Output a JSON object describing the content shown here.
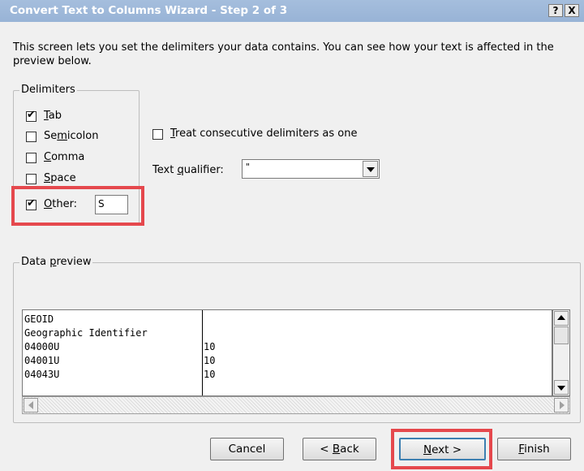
{
  "window": {
    "title": "Convert Text to Columns Wizard - Step 2 of 3",
    "help_label": "?",
    "close_label": "X"
  },
  "intro_text": "This screen lets you set the delimiters your data contains.  You can see how your text is affected in the preview below.",
  "delimiters": {
    "legend": "Delimiters",
    "tab": {
      "label_hot": "T",
      "label_rest": "ab",
      "checked": true
    },
    "semicolon": {
      "label_pre": "Se",
      "label_hot": "m",
      "label_rest": "icolon",
      "checked": false
    },
    "comma": {
      "label_hot": "C",
      "label_rest": "omma",
      "checked": false
    },
    "space": {
      "label_hot": "S",
      "label_rest": "pace",
      "checked": false
    },
    "other": {
      "label_hot": "O",
      "label_rest": "ther:",
      "checked": true,
      "value": "S"
    }
  },
  "consecutive": {
    "label_hot": "T",
    "label_rest": "reat consecutive delimiters as one",
    "checked": false
  },
  "qualifier": {
    "label_pre": "Text ",
    "label_hot": "q",
    "label_rest": "ualifier:",
    "value": "\""
  },
  "preview": {
    "legend_pre": "Data ",
    "legend_hot": "p",
    "legend_rest": "review",
    "rows": [
      {
        "c1": "GEOID",
        "c2": ""
      },
      {
        "c1": "Geographic Identifier",
        "c2": ""
      },
      {
        "c1": "04000U",
        "c2": "10"
      },
      {
        "c1": "04001U",
        "c2": "10"
      },
      {
        "c1": "04043U",
        "c2": "10"
      }
    ]
  },
  "buttons": {
    "cancel": "Cancel",
    "back": {
      "pre": "< ",
      "hot": "B",
      "rest": "ack"
    },
    "next": {
      "hot": "N",
      "rest": "ext >"
    },
    "finish": {
      "hot": "F",
      "rest": "inish"
    }
  },
  "highlight_color": "#e5484d"
}
